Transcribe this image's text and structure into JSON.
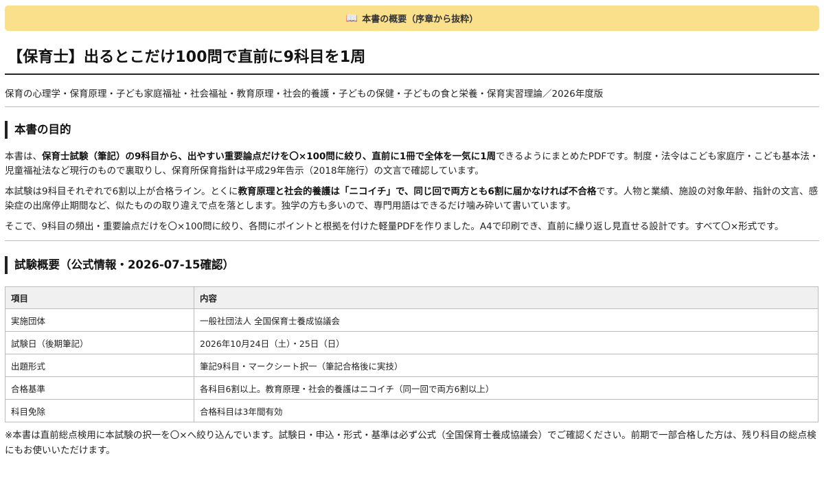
{
  "banner": {
    "icon": "book-icon",
    "text": "本書の概要（序章から抜粋）"
  },
  "title": "【保育士】出るとこだけ100問で直前に9科目を1周",
  "subjects": "保育の心理学・保育原理・子ども家庭福祉・社会福祉・教育原理・社会的養護・子どもの保健・子どもの食と栄養・保育実習理論／2026年度版",
  "purpose": {
    "heading": "本書の目的",
    "p1": [
      {
        "t": "本書は、",
        "b": false
      },
      {
        "t": "保育士試験（筆記）の9科目から、出やすい重要論点だけを〇×100問に絞り、直前に1冊で全体を一気に1周",
        "b": true
      },
      {
        "t": "できるようにまとめたPDFです。制度・法令はこども家庭庁・こども基本法・児童福祉法など現行のもので裏取りし、保育所保育指針は平成29年告示（2018年施行）の文言で確認しています。",
        "b": false
      }
    ],
    "p2": [
      {
        "t": "本試験は9科目それぞれで6割以上が合格ライン。とくに",
        "b": false
      },
      {
        "t": "教育原理と社会的養護は「ニコイチ」で、同じ回で両方とも6割に届かなければ不合格",
        "b": true
      },
      {
        "t": "です。人物と業績、施設の対象年齢、指針の文言、感染症の出席停止期間など、似たものの取り違えで点を落とします。独学の方も多いので、専門用語はできるだけ噛み砕いて書いています。",
        "b": false
      }
    ],
    "p3": "そこで、9科目の頻出・重要論点だけを〇×100問に絞り、各問にポイントと根拠を付けた軽量PDFを作りました。A4で印刷でき、直前に繰り返し見直せる設計です。すべて〇×形式です。"
  },
  "exam": {
    "heading": "試験概要（公式情報・2026-07-15確認）",
    "headers": [
      "項目",
      "内容"
    ],
    "rows": [
      [
        "実施団体",
        "一般社団法人 全国保育士養成協議会"
      ],
      [
        "試験日（後期筆記）",
        "2026年10月24日（土）・25日（日）"
      ],
      [
        "出題形式",
        "筆記9科目・マークシート択一（筆記合格後に実技）"
      ],
      [
        "合格基準",
        "各科目6割以上。教育原理・社会的養護はニコイチ（同一回で両方6割以上）"
      ],
      [
        "科目免除",
        "合格科目は3年間有効"
      ]
    ],
    "note": "※本書は直前総点検用に本試験の択一を〇×へ絞り込んでいます。試験日・申込・形式・基準は必ず公式（全国保育士養成協議会）でご確認ください。前期で一部合格した方は、残り科目の総点検にもお使いいただけます。"
  }
}
